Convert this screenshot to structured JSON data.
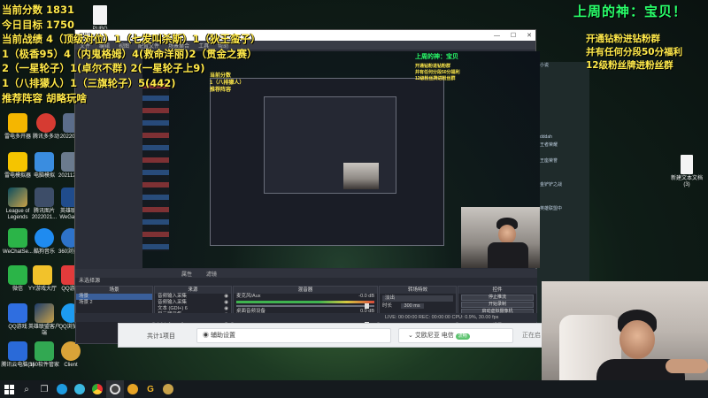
{
  "overlay_left": {
    "lines": [
      "当前分数 1831",
      "今日目标 1750",
      "当前战绩 4（顶级对位）1（七发叫杀斯）1（狄王蛮子）",
      "1（极香95）4（内鬼格姆）4(救命洋丽)2（贯金之赛）",
      "2（一星轮子）1(卓尔不群) 2(一星轮子上9)",
      " 1（八排獴人）1（三旗轮子）5(442)",
      "推荐阵容 胡略玩啥"
    ]
  },
  "overlay_top_right": "上周的神：宝贝！",
  "overlay_right": {
    "lines": [
      "开通钻粉进钻粉群",
      "并有任何分段50分福利",
      "12级粉丝牌进粉丝群"
    ]
  },
  "desktop_icons": [
    {
      "label": "PUBG"
    },
    {
      "label": "雷电多开器"
    },
    {
      "label": "腾讯多多动"
    },
    {
      "label": "2022021..."
    },
    {
      "label": "雷电模拟器"
    },
    {
      "label": "电脑模拟"
    },
    {
      "label": "2021120..."
    },
    {
      "label": "League of Legends"
    },
    {
      "label": "腾讯图片 2022021..."
    },
    {
      "label": "英雄联盟 WeGame"
    },
    {
      "label": "WeChatSe..."
    },
    {
      "label": "酷狗音乐"
    },
    {
      "label": "360浏览器"
    },
    {
      "label": "微信"
    },
    {
      "label": "YY游戏大厅"
    },
    {
      "label": "QQ游戏"
    },
    {
      "label": "QQ游戏"
    },
    {
      "label": "英雄联盟客户端"
    },
    {
      "label": "QQ浏览器"
    },
    {
      "label": "腾讯云电脑(1)"
    },
    {
      "label": "360软件管家"
    },
    {
      "label": "Client"
    },
    {
      "label": "新建文本文档 (3)"
    }
  ],
  "obs": {
    "window_title": "OBS",
    "menu": [
      "文件",
      "编辑",
      "视图",
      "配置文件",
      "场景集合",
      "工具",
      "帮助"
    ],
    "preview_overlay_title": "上周的神：宝贝",
    "preview_overlay_lines": [
      "开通钻粉进钻粉群",
      "并有任何分段50分福利",
      "12级粉丝牌进粉丝群"
    ],
    "preview_left_lines": [
      "当前分数",
      "1（八排獴人）",
      "推荐阵容"
    ],
    "tabs": [
      "属性",
      "滤镜"
    ],
    "scene_bar": "未选择源",
    "scenes": {
      "header": "场景",
      "items": [
        "场景",
        "场景 2"
      ]
    },
    "sources": {
      "header": "来源",
      "items": [
        "音频输入采集",
        "音频输入采集",
        "文本 (GDI+) 6",
        "显示器采集",
        "文本 (GDI+) 3",
        "文本 (GDI+) 2",
        "文本 (GDI+) 1"
      ]
    },
    "mixer": {
      "header": "混音器",
      "channels": [
        {
          "name": "麦克风/Aux",
          "db": "-0.0 dB"
        },
        {
          "name": "桌面音频设备",
          "db": "0.0 dB"
        },
        {
          "name": "音频输入采集",
          "db": "0.0 dB"
        }
      ]
    },
    "transitions": {
      "header": "转场特效",
      "type": "淡出",
      "duration_label": "时长",
      "duration": "300 ms"
    },
    "controls": {
      "header": "控件",
      "buttons": [
        "停止推流",
        "开始录制",
        "启动虚拟摄像机",
        "工作室模式",
        "设置",
        "退出"
      ]
    },
    "status": "LIVE: 00:00:00  REC: 00:00:00  CPU: 0.9%, 30.00 fps"
  },
  "side_window": {
    "lines": [
      "小说",
      "",
      "",
      "",
      "",
      "",
      "",
      "",
      "",
      "dddah",
      "王者荣耀",
      "",
      "王座荣誉",
      "",
      "",
      "金铲铲之战",
      "",
      "",
      "英雄联盟中",
      "",
      "",
      "",
      ""
    ]
  },
  "installer": {
    "left_label": "共计1项目",
    "settings_label": "辅助设置",
    "engine_label": "艾欧尼亚 电信",
    "engine_badge": "流畅",
    "status_label": "正在启"
  },
  "taskbar": {
    "icons": [
      "windows-icon",
      "search-icon",
      "task-view-icon",
      "edge-icon",
      "browser-icon",
      "chrome-icon",
      "obs-icon",
      "game-icon",
      "wegame-icon",
      "lol-icon"
    ]
  }
}
